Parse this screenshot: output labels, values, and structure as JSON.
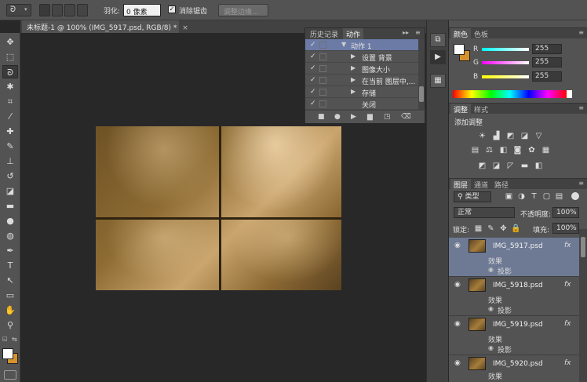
{
  "options_bar": {
    "feather_label": "羽化:",
    "feather_value": "0 像素",
    "antialias_label": "消除锯齿",
    "refine_edge_label": "调整边缘..."
  },
  "document_tab": {
    "title": "未标题-1 @ 100% (IMG_5917.psd, RGB/8) *",
    "close": "×"
  },
  "toolbar": {
    "tools": [
      "move-tool",
      "marquee-tool",
      "lasso-tool",
      "magic-wand-tool",
      "crop-tool",
      "eyedropper-tool",
      "healing-tool",
      "brush-tool",
      "clone-stamp-tool",
      "history-brush-tool",
      "eraser-tool",
      "gradient-tool",
      "blur-tool",
      "dodge-tool",
      "pen-tool",
      "type-tool",
      "path-select-tool",
      "shape-tool",
      "hand-tool",
      "zoom-tool"
    ]
  },
  "actions_panel": {
    "tabs": [
      "历史记录",
      "动作"
    ],
    "active_tab": "动作",
    "rows": [
      {
        "label": "动作 1",
        "level": 0,
        "expanded": true
      },
      {
        "label": "设置 背景",
        "level": 1
      },
      {
        "label": "图像大小",
        "level": 1
      },
      {
        "label": "在当前 图层中,...",
        "level": 1
      },
      {
        "label": "存储",
        "level": 1
      },
      {
        "label": "关闭",
        "level": 1
      }
    ]
  },
  "color_panel": {
    "tabs": [
      "颜色",
      "色板"
    ],
    "channels": [
      {
        "label": "R",
        "value": "255"
      },
      {
        "label": "G",
        "value": "255"
      },
      {
        "label": "B",
        "value": "255"
      }
    ],
    "foreground": "#ffffff",
    "background": "#d4912e"
  },
  "adjustments_panel": {
    "tabs": [
      "调整",
      "样式"
    ],
    "heading": "添加调整"
  },
  "layers_panel": {
    "tabs": [
      "图层",
      "通道",
      "路径"
    ],
    "filter_label": "类型",
    "blend_mode": "正常",
    "opacity_label": "不透明度:",
    "opacity_value": "100%",
    "lock_label": "锁定:",
    "fill_label": "填充:",
    "fill_value": "100%",
    "layers": [
      {
        "name": "IMG_5917.psd",
        "effects": "效果",
        "effect": "投影",
        "selected": true
      },
      {
        "name": "IMG_5918.psd",
        "effects": "效果",
        "effect": "投影",
        "selected": false
      },
      {
        "name": "IMG_5919.psd",
        "effects": "效果",
        "effect": "投影",
        "selected": false
      },
      {
        "name": "IMG_5920.psd",
        "effects": "效果",
        "effect": "",
        "selected": false
      }
    ],
    "fx": "fx"
  }
}
